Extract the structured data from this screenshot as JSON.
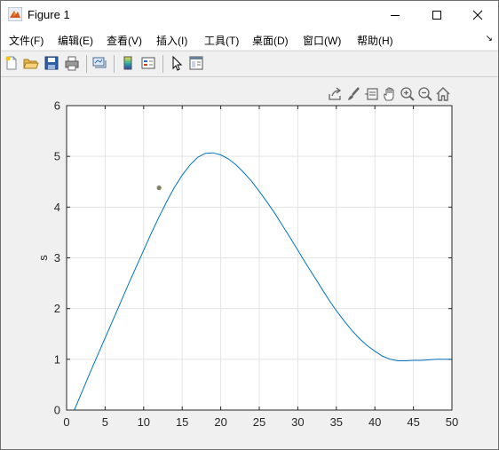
{
  "window": {
    "title": "Figure 1",
    "controls": [
      "minimize",
      "maximize",
      "close"
    ]
  },
  "menubar": {
    "items": [
      "文件(F)",
      "编辑(E)",
      "查看(V)",
      "插入(I)",
      "工具(T)",
      "桌面(D)",
      "窗口(W)",
      "帮助(H)"
    ],
    "overflow": "↘"
  },
  "toolbar": {
    "icons": [
      "new-figure-icon",
      "open-file-icon",
      "save-icon",
      "print-icon",
      "link-plot-icon",
      "colorbar-icon",
      "legend-icon",
      "pointer-icon",
      "property-editor-icon"
    ]
  },
  "axes_toolbar": {
    "icons": [
      "export-icon",
      "brush-icon",
      "data-tips-icon",
      "pan-icon",
      "zoom-in-icon",
      "zoom-out-icon",
      "home-icon"
    ]
  },
  "chart_data": {
    "type": "line",
    "title": "",
    "xlabel": "",
    "ylabel": "s",
    "xlim": [
      0,
      50
    ],
    "ylim": [
      0,
      6
    ],
    "xticks": [
      0,
      5,
      10,
      15,
      20,
      25,
      30,
      35,
      40,
      45,
      50
    ],
    "yticks": [
      0,
      1,
      2,
      3,
      4,
      5,
      6
    ],
    "grid": true,
    "line_color": "#0072bd",
    "marker_color": "#808060",
    "series": [
      {
        "x": [
          1,
          2,
          3,
          4,
          5,
          6,
          7,
          8,
          9,
          10,
          11,
          12,
          13,
          14,
          15,
          16,
          17,
          18,
          19,
          20,
          21,
          22,
          23,
          24,
          25,
          26,
          27,
          28,
          29,
          30,
          31,
          32,
          33,
          34,
          35,
          36,
          37,
          38,
          39,
          40,
          41,
          42,
          43,
          44,
          45,
          46,
          47,
          48,
          49,
          50
        ],
        "y": [
          0,
          0.36,
          0.72,
          1.07,
          1.42,
          1.77,
          2.12,
          2.47,
          2.81,
          3.15,
          3.49,
          3.81,
          4.11,
          4.39,
          4.63,
          4.83,
          4.98,
          5.06,
          5.07,
          5.03,
          4.95,
          4.83,
          4.68,
          4.51,
          4.31,
          4.1,
          3.88,
          3.64,
          3.4,
          3.15,
          2.9,
          2.66,
          2.42,
          2.18,
          1.96,
          1.76,
          1.57,
          1.41,
          1.27,
          1.16,
          1.06,
          1.0,
          0.97,
          0.97,
          0.98,
          0.98,
          0.99,
          1.0,
          1.0,
          1.0
        ]
      }
    ],
    "marker": {
      "x": 12,
      "y": 4.38
    }
  }
}
